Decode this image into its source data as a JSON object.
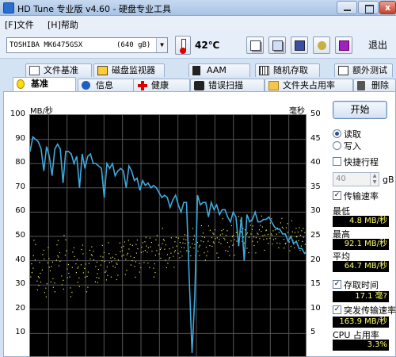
{
  "app": {
    "title": "HD Tune 专业版 v4.60 - 硬盘专业工具",
    "close_glyph": "x"
  },
  "menu": {
    "file": "[F]文件",
    "help": "[H]帮助"
  },
  "toolbar": {
    "drive": "TOSHIBA MK6475GSX",
    "capacity": "(640 gB)",
    "temperature": "42℃",
    "exit_label": "退出"
  },
  "tabs_row1": [
    {
      "label": "文件基准"
    },
    {
      "label": "磁盘监视器"
    },
    {
      "label": "AAM"
    },
    {
      "label": "随机存取"
    },
    {
      "label": "额外测试"
    }
  ],
  "tabs_row2": [
    {
      "label": "基准"
    },
    {
      "label": "信息"
    },
    {
      "label": "健康"
    },
    {
      "label": "错误扫描"
    },
    {
      "label": "文件夹占用率"
    },
    {
      "label": "删除"
    }
  ],
  "chart": {
    "left_unit": "MB/秒",
    "right_unit": "毫秒",
    "left_ticks": [
      "100",
      "90",
      "80",
      "70",
      "60",
      "50",
      "40",
      "30",
      "20",
      "10"
    ],
    "right_ticks": [
      "50",
      "45",
      "40",
      "35",
      "30",
      "25",
      "20",
      "15",
      "10",
      "5"
    ]
  },
  "side": {
    "start_label": "开始",
    "read_label": "读取",
    "write_label": "写入",
    "quick_label": "快捷行程",
    "quick_value": "40",
    "gb_label": "gB",
    "transfer_label": "传输速率",
    "min_label": "最低",
    "min_value": "4.8 MB/秒",
    "max_label": "最高",
    "max_value": "92.1 MB/秒",
    "avg_label": "平均",
    "avg_value": "64.7 MB/秒",
    "access_label": "存取时间",
    "access_value": "17.1 毫?",
    "burst_label": "突发传输速率",
    "burst_value": "163.9 MB/秒",
    "cpu_label": "CPU 占用率",
    "cpu_value": "3.3%"
  },
  "chart_data": {
    "type": "line",
    "title": "",
    "xlabel": "",
    "ylabel": "MB/秒",
    "y2label": "毫秒",
    "ylim": [
      0,
      100
    ],
    "y2lim": [
      0,
      50
    ],
    "grid": true,
    "series": [
      {
        "values": [
          85,
          91,
          90,
          89,
          86,
          77,
          87,
          83,
          75,
          86,
          88,
          86,
          72,
          85,
          85,
          84,
          80,
          83,
          70,
          84,
          78,
          83,
          84,
          80,
          80,
          79,
          78,
          66,
          80,
          78,
          80,
          75,
          77,
          78,
          77,
          70,
          79,
          77,
          73,
          74,
          69,
          73,
          71,
          72,
          70,
          71,
          70,
          68,
          66,
          67,
          66,
          62,
          65,
          67,
          63,
          60,
          64,
          64,
          32,
          2,
          25,
          67,
          63,
          64,
          64,
          58,
          64,
          61,
          63,
          59,
          61,
          61,
          58,
          56,
          60,
          58,
          46,
          58,
          40,
          59,
          56,
          57,
          60,
          56,
          56,
          57,
          57,
          58,
          56,
          54,
          53,
          53,
          51,
          51,
          48,
          50,
          47,
          48,
          45,
          45,
          43,
          44
        ]
      },
      {
        "values": [
          38,
          45,
          30,
          35,
          40,
          28,
          42,
          36,
          31,
          44,
          39,
          33,
          47,
          35,
          29,
          41,
          38,
          34,
          43,
          37,
          31,
          40,
          45,
          36,
          33,
          42,
          39,
          35,
          44,
          38,
          41,
          36,
          43,
          47,
          39,
          45,
          42,
          37,
          46,
          40,
          44,
          48,
          41,
          45,
          38,
          47,
          43,
          49,
          44,
          40,
          46,
          42,
          48,
          45,
          43,
          50,
          47,
          44,
          49,
          46,
          45,
          51,
          48,
          44,
          50,
          47,
          52,
          46,
          49,
          53,
          48,
          45,
          51,
          47,
          50,
          54,
          49,
          52,
          48,
          53,
          50,
          47,
          52,
          55,
          49,
          51,
          53,
          48,
          52,
          50,
          54,
          49,
          51,
          47,
          53,
          50,
          52,
          48,
          49,
          46
        ]
      }
    ]
  }
}
